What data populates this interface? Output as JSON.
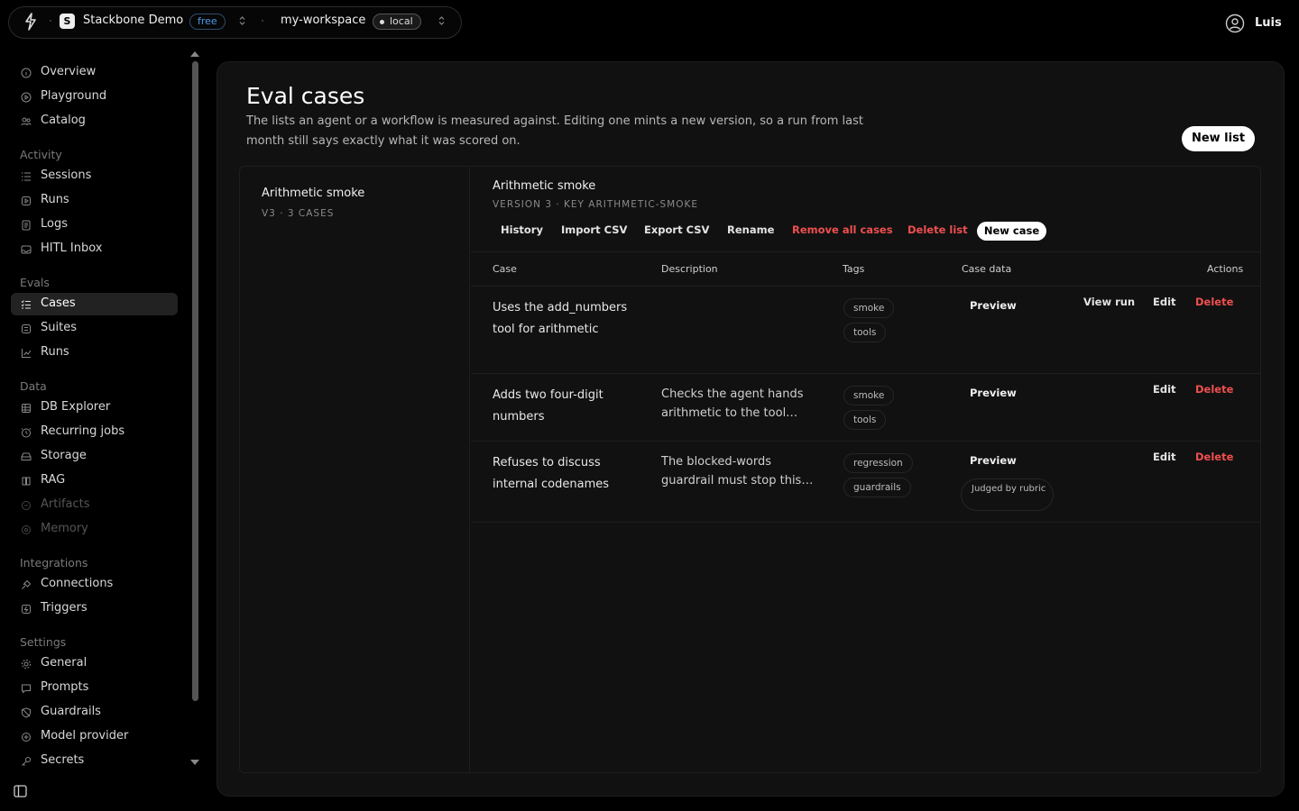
{
  "topbar": {
    "project_initial": "S",
    "project_name": "Stackbone Demo",
    "plan_badge": "free",
    "workspace": "my-workspace",
    "env_badge": "local",
    "user_name": "Luis"
  },
  "sidebar": {
    "top": [
      {
        "label": "Overview",
        "icon": "info-circle-icon"
      },
      {
        "label": "Playground",
        "icon": "play-icon"
      },
      {
        "label": "Catalog",
        "icon": "agents-icon"
      }
    ],
    "activity_title": "Activity",
    "activity": [
      {
        "label": "Sessions",
        "icon": "list-icon"
      },
      {
        "label": "Runs",
        "icon": "runs-icon"
      },
      {
        "label": "Logs",
        "icon": "file-icon"
      },
      {
        "label": "HITL Inbox",
        "icon": "inbox-icon"
      }
    ],
    "evals_title": "Evals",
    "evals": [
      {
        "label": "Cases",
        "icon": "checklist-icon",
        "active": true
      },
      {
        "label": "Suites",
        "icon": "suites-icon"
      },
      {
        "label": "Runs",
        "icon": "chart-icon"
      }
    ],
    "data_title": "Data",
    "data": [
      {
        "label": "DB Explorer",
        "icon": "database-icon"
      },
      {
        "label": "Recurring jobs",
        "icon": "clock-icon"
      },
      {
        "label": "Storage",
        "icon": "storage-icon"
      },
      {
        "label": "RAG",
        "icon": "rag-icon"
      },
      {
        "label": "Artifacts",
        "icon": "artifacts-icon",
        "disabled": true
      },
      {
        "label": "Memory",
        "icon": "memory-icon",
        "disabled": true
      }
    ],
    "integrations_title": "Integrations",
    "integrations": [
      {
        "label": "Connections",
        "icon": "plug-icon"
      },
      {
        "label": "Triggers",
        "icon": "trigger-icon"
      }
    ],
    "settings_title": "Settings",
    "settings": [
      {
        "label": "General",
        "icon": "gear-icon"
      },
      {
        "label": "Prompts",
        "icon": "prompt-icon"
      },
      {
        "label": "Guardrails",
        "icon": "shield-icon"
      },
      {
        "label": "Model provider",
        "icon": "model-icon"
      },
      {
        "label": "Secrets",
        "icon": "key-icon"
      }
    ]
  },
  "page": {
    "title": "Eval cases",
    "subtitle": "The lists an agent or a workflow is measured against. Editing one mints a new version, so a run from last month still says exactly what it was scored on.",
    "new_list_label": "New list"
  },
  "lists": [
    {
      "name": "Arithmetic smoke",
      "meta": "V3 · 3 CASES"
    }
  ],
  "detail": {
    "title": "Arithmetic smoke",
    "meta": "VERSION 3 · KEY ARITHMETIC-SMOKE",
    "actions": {
      "history": "History",
      "import_csv": "Import CSV",
      "export_csv": "Export CSV",
      "rename": "Rename",
      "remove_all": "Remove all cases",
      "delete_list": "Delete list",
      "new_case": "New case"
    },
    "columns": {
      "case": "Case",
      "description": "Description",
      "tags": "Tags",
      "case_data": "Case data",
      "actions": "Actions"
    },
    "rows": [
      {
        "case": "Uses the add_numbers tool for arithmetic",
        "description": "",
        "tags": [
          "smoke",
          "tools"
        ],
        "preview": "Preview",
        "view_run": "View run",
        "edit": "Edit",
        "delete": "Delete"
      },
      {
        "case": "Adds two four-digit numbers",
        "description": "Checks the agent hands arithmetic to the tool…",
        "tags": [
          "smoke",
          "tools"
        ],
        "preview": "Preview",
        "edit": "Edit",
        "delete": "Delete"
      },
      {
        "case": "Refuses to discuss internal codenames",
        "description": "The blocked-words guardrail must stop this…",
        "tags": [
          "regression",
          "guardrails"
        ],
        "preview": "Preview",
        "judged": "Judged by rubric",
        "edit": "Edit",
        "delete": "Delete"
      }
    ]
  }
}
